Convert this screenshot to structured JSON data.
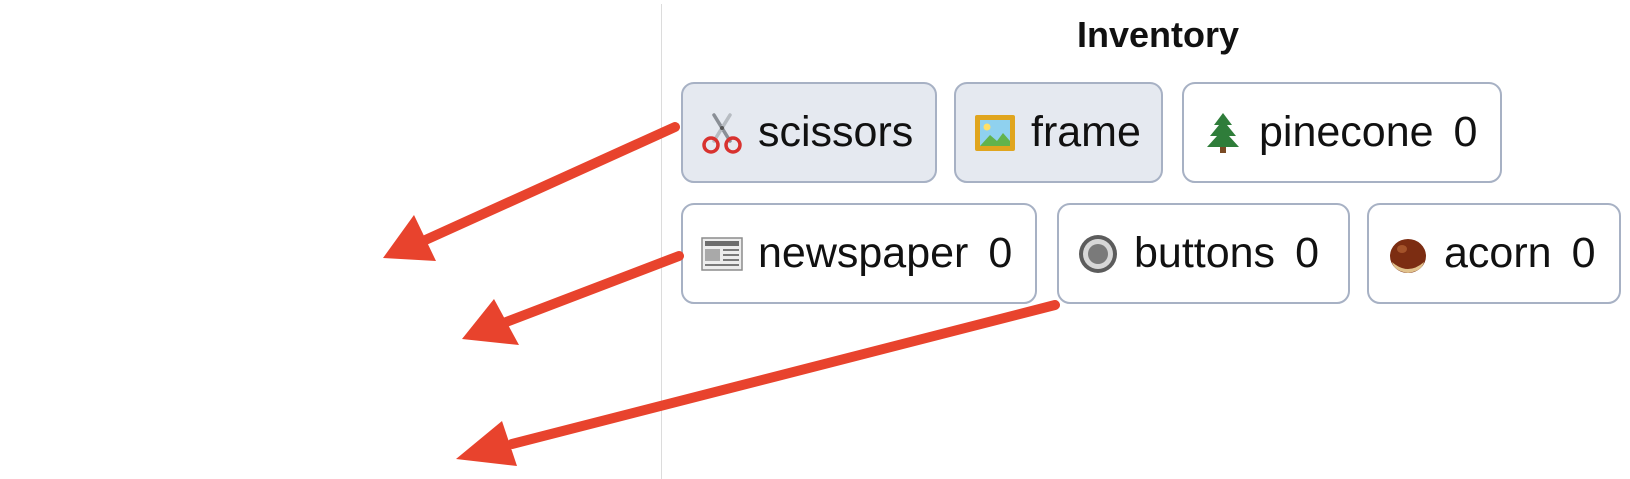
{
  "inventory": {
    "title": "Inventory",
    "items": [
      {
        "id": "scissors",
        "icon": "scissors-icon",
        "label": "scissors",
        "count": "",
        "selected": true
      },
      {
        "id": "frame",
        "icon": "framed-picture-icon",
        "label": "frame",
        "count": "",
        "selected": true
      },
      {
        "id": "pinecone",
        "icon": "pine-tree-icon",
        "label": "pinecone",
        "count": "0",
        "selected": false
      },
      {
        "id": "newspaper",
        "icon": "newspaper-icon",
        "label": "newspaper",
        "count": "0",
        "selected": false
      },
      {
        "id": "buttons",
        "icon": "radio-button-icon",
        "label": "buttons",
        "count": "0",
        "selected": false
      },
      {
        "id": "acorn",
        "icon": "chestnut-icon",
        "label": "acorn",
        "count": "0",
        "selected": false
      }
    ]
  },
  "colors": {
    "arrow": "#e8432d",
    "selected_bg": "#e5e9f0",
    "item_border": "#a7b1c4",
    "divider": "#dcdcdc"
  }
}
